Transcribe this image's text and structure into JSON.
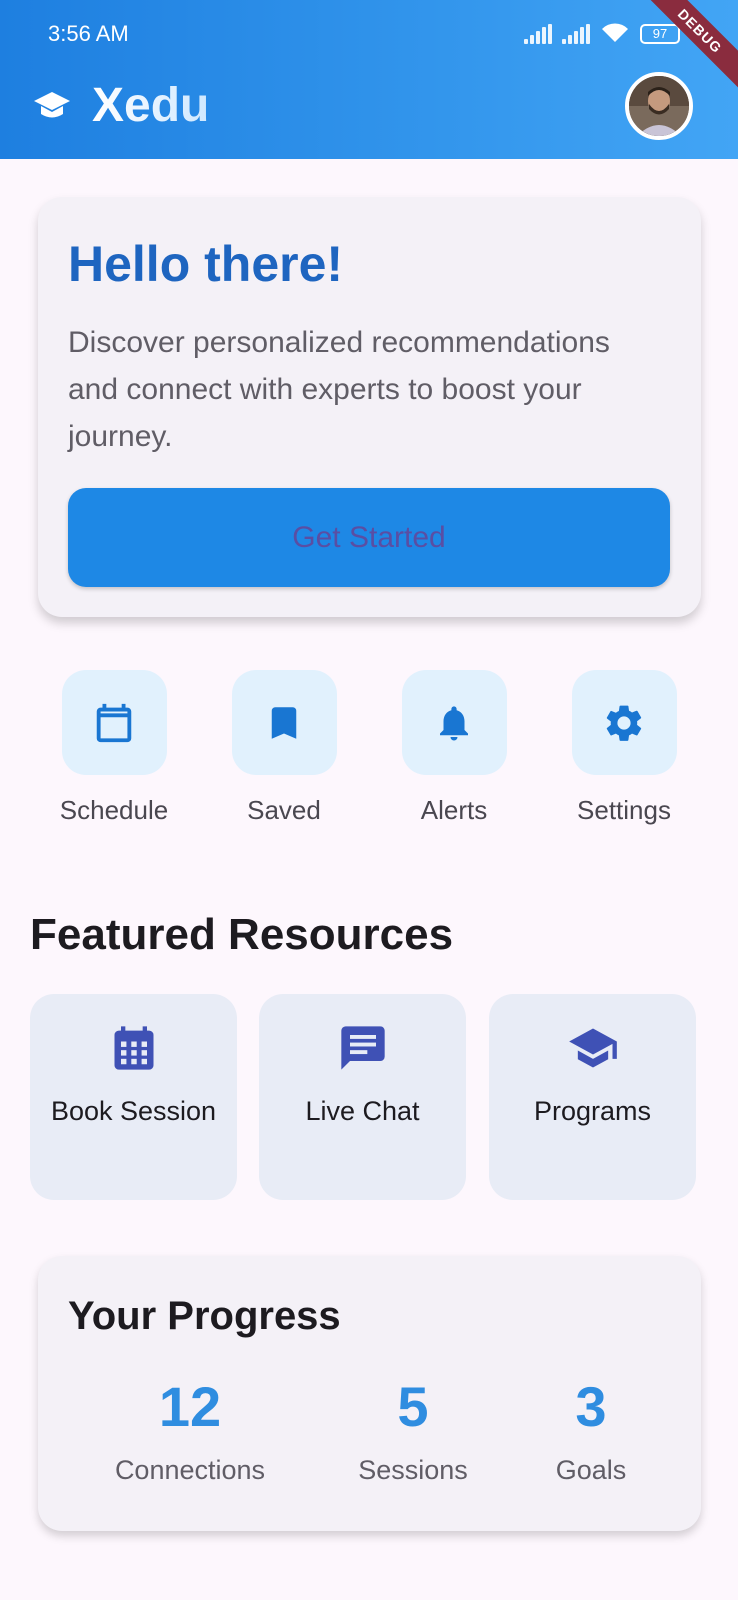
{
  "status_bar": {
    "time": "3:56 AM",
    "battery": "97",
    "debug_banner": "DEBUG"
  },
  "app_bar": {
    "title": "Xedu",
    "logo_icon": "graduation-cap-icon"
  },
  "hero": {
    "heading": "Hello there!",
    "description": "Discover personalized recommendations and connect with experts to boost your journey.",
    "cta_label": "Get Started"
  },
  "quick_actions": [
    {
      "label": "Schedule",
      "icon": "calendar-icon"
    },
    {
      "label": "Saved",
      "icon": "bookmark-icon"
    },
    {
      "label": "Alerts",
      "icon": "bell-icon"
    },
    {
      "label": "Settings",
      "icon": "gear-icon"
    }
  ],
  "featured": {
    "title": "Featured Resources",
    "items": [
      {
        "label": "Book Session",
        "icon": "calendar-grid-icon"
      },
      {
        "label": "Live Chat",
        "icon": "chat-icon"
      },
      {
        "label": "Programs",
        "icon": "graduation-cap-icon"
      }
    ]
  },
  "progress": {
    "title": "Your Progress",
    "stats": [
      {
        "value": "12",
        "label": "Connections"
      },
      {
        "value": "5",
        "label": "Sessions"
      },
      {
        "value": "3",
        "label": "Goals"
      }
    ]
  },
  "colors": {
    "primary": "#1E88E5",
    "heading_blue": "#1E65C0",
    "stat_blue": "#2F8DE0",
    "icon_blue": "#1976D2",
    "indigo_icon": "#3F51B5",
    "background": "#FDF7FD"
  }
}
